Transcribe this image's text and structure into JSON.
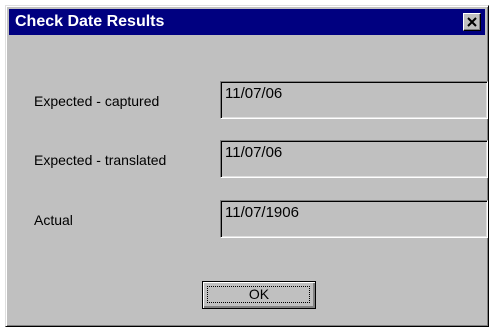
{
  "window": {
    "title": "Check Date Results",
    "close_icon": "close-icon"
  },
  "fields": [
    {
      "label": "Expected - captured",
      "value": "11/07/06"
    },
    {
      "label": "Expected - translated",
      "value": "11/07/06"
    },
    {
      "label": "Actual",
      "value": "11/07/1906"
    }
  ],
  "buttons": {
    "ok_label": "OK"
  },
  "colors": {
    "title_bar": "#000080",
    "face": "#c0c0c0"
  }
}
